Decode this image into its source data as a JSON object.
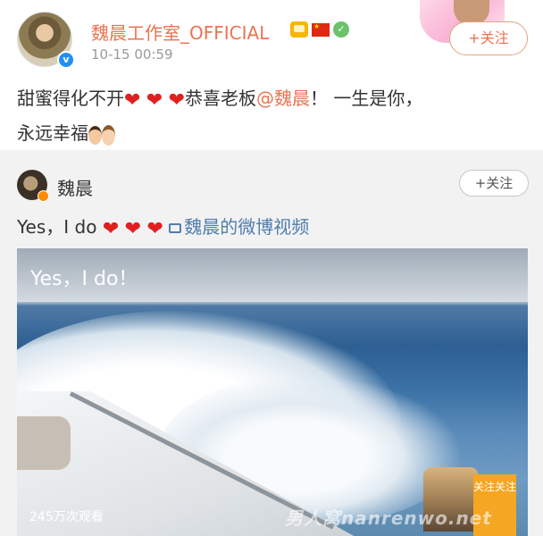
{
  "post": {
    "username": "魏晨工作室_OFFICIAL",
    "time": "10-15 00:59",
    "follow_label": "+关注",
    "text_part1": "甜蜜得化不开",
    "hearts": "❤",
    "text_part2": "恭喜老板",
    "mention": "@魏晨",
    "text_part3": "！ 一生是你，",
    "text_line2": "永远幸福"
  },
  "repost": {
    "username": "魏晨",
    "follow_label": "+关注",
    "text": "Yes，I do",
    "video_link_label": "魏晨的微博视频"
  },
  "video": {
    "caption": "Yes，I do！",
    "view_count": "245万次观看",
    "thumb_badge": "关注关注",
    "watermark": "男人窝nanrenwo.net"
  },
  "colors": {
    "username": "#eb7350",
    "link": "#507daf",
    "heart": "#e02020",
    "verified": "#1f8ff2"
  }
}
